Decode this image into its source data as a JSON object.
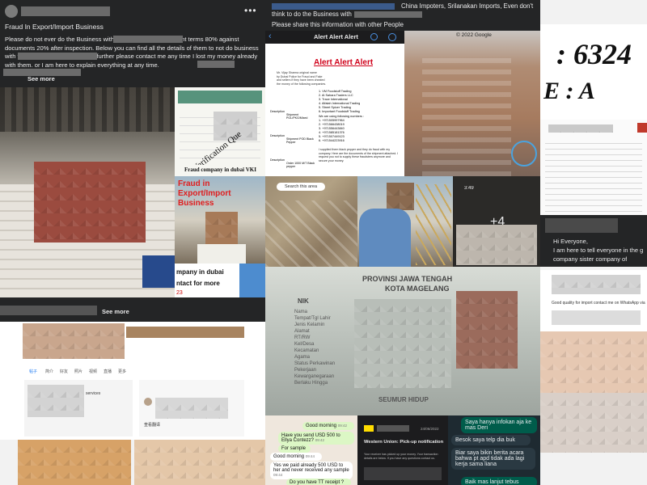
{
  "post": {
    "title": "Fraud In Export/Import Business",
    "body": "Please do not ever do the Business with                     . They asked the payment terms 80% against documents 20% after inspection. Below you can find all the details of them                                to not do business with this company. If you all need further please contact me any time I lost my money already with them.                                or                                I am here to explain everything at any time.",
    "see_more": "See more",
    "see_more_2": "See more",
    "menu_icon": "ellipsis-icon"
  },
  "top_right_post": {
    "line1": "China Impoters, Srilanakan Imports, Even don't think to do the Business with",
    "line2": "Please share this information with other People"
  },
  "alert_app": {
    "header": "Alert Alert Alert",
    "heading": "Alert Alert Alert",
    "back_icon": "chevron-left-icon",
    "search_icon": "search-icon",
    "share_icon": "share-icon",
    "doc_lines": [
      "Mr. Vijay Sharma original name",
      "by Dubai Police for Fraud and Fake",
      "and sellers if they have been cheated",
      "the money of the following companies."
    ],
    "companies": [
      "1.  VM Foodstuff Trading",
      "2.  Al Sahara Traders LLC",
      "3.  Trace International",
      "4.  Alfalah International Trading",
      "5.  Street Spicer Trading",
      "6.  Important Foodstuff Trading"
    ],
    "phones_label": "We are using following numbers :",
    "phones": [
      "1.  +971505997964",
      "2.  +971566438019",
      "3.  +971556443840",
      "4.  +971585181376",
      "5.  +971507449123",
      "6.  +971544223916"
    ],
    "doc_footer": "I supplied them black pepper and they do fraud with my company. Here are the documents of the shipment attached. I request you not to supply these fraudsters anymore and secure your money.",
    "row_labels": [
      "Description",
      "Description",
      "Description"
    ],
    "row_values": [
      "Shipment POL/PKG/Mixed",
      "Shipment POD Black Pepper",
      "Order 1000 M/T Black pepper"
    ]
  },
  "map": {
    "google_copyright": "© 2022 Google",
    "search_area": "Search this area"
  },
  "large_text": {
    "line1": ": 6324",
    "line2": "E  : A"
  },
  "photo_captions": {
    "verification": "For Verification Que",
    "fraud_dubai": "Fraud company in dubai VKI",
    "fraud_export": "Fraud in Export/Import Business",
    "company_dubai": "mpany in dubai",
    "contact": "ntact for more",
    "num_ca": "ca",
    "num_23": "23"
  },
  "overlay": {
    "plus_count": "+4",
    "time": "3:49"
  },
  "hi_everyone": {
    "line1": "Hi Everyone,",
    "line2": "I am here to tell everyone in the g",
    "line3": "company sister company of"
  },
  "whatsapp_quality": {
    "text": "Good quality for import contact me on WhatsApp via"
  },
  "id_card": {
    "province": "PROVINSI JAWA TENGAH",
    "city": "KOTA MAGELANG",
    "nik": "NIK",
    "fields": [
      "Nama",
      "Tempat/Tgl Lahir",
      "Jenis Kelamin",
      "Alamat",
      "RT/RW",
      "Kel/Desa",
      "Kecamatan",
      "Agama",
      "Status Perkawinan",
      "Pekerjaan",
      "Kewarganegaraan",
      "Berlaku Hingga"
    ],
    "footer": "SEUMUR HIDUP"
  },
  "chat_left": {
    "messages": [
      {
        "text": "Good morning",
        "time": "09:42",
        "side": "out"
      },
      {
        "text": "Have you send USD 500 to Ellya Contezz?",
        "time": "09:42",
        "side": "out"
      },
      {
        "text": "For sample",
        "time": "",
        "side": "out"
      },
      {
        "text": "Good morning",
        "time": "09:44",
        "side": "in"
      },
      {
        "text": "Yes we paid already 500 USD to her and never received any sample",
        "time": "09:44",
        "side": "in"
      },
      {
        "text": "Do you have TT receipt ?",
        "time": "",
        "side": "out"
      }
    ]
  },
  "western_union": {
    "time": "3:40",
    "date": "24/06/2022",
    "title": "Western Union: Pick-up notification",
    "body": "Your receiver has picked up your money. Your transaction details are below. If you have any questions contact us."
  },
  "chat_right": {
    "messages": [
      {
        "text": "Saya hanya infokan aja ke mas Deri",
        "side": "out"
      },
      {
        "text": "Besok saya telp dia buk",
        "side": "in"
      },
      {
        "text": "Biar saya bikin berita acara bahwa pt apd tidak ada lagi kerja sama liana",
        "side": "in"
      },
      {
        "text": "Baik mas lanjut tebus",
        "side": "out"
      }
    ]
  },
  "facebook_ui": {
    "tabs": [
      "帖子",
      "简介",
      "好友",
      "照片",
      "视频",
      "直播",
      "更多"
    ],
    "service_text": "services",
    "footer_text": "查看翻译"
  },
  "colors": {
    "facebook_dark": "#242526",
    "alert_red": "#d0021b",
    "link_blue": "#1877f2",
    "whatsapp_green": "#dcf7c5",
    "whatsapp_dark": "#005c4b"
  }
}
